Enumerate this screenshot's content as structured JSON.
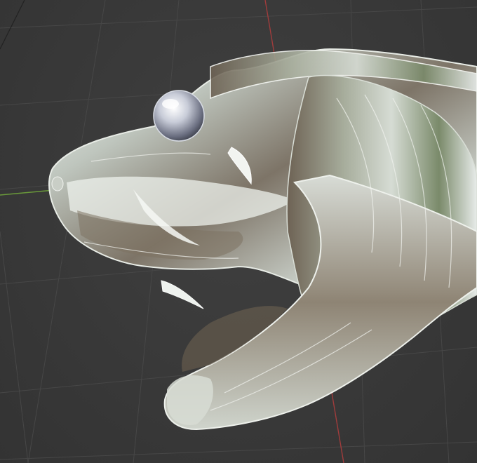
{
  "viewport": {
    "background_color": "#393939",
    "grid_color": "#454545",
    "x_axis_color": "#a03c3c",
    "y_axis_color": "#6a9a3a"
  },
  "model": {
    "material": "glass",
    "eye_color": "#c8ccd8"
  }
}
